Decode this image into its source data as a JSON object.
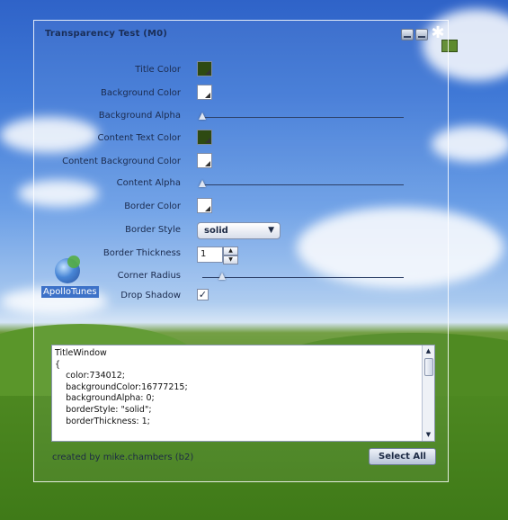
{
  "window": {
    "title": "Transparency Test (M0)",
    "buttons": [
      "minimize",
      "maximize",
      "close"
    ]
  },
  "form": {
    "title_color_label": "Title Color",
    "title_color_value": "#2e4a12",
    "background_color_label": "Background Color",
    "background_color_value": "#ffffff",
    "background_alpha_label": "Background Alpha",
    "background_alpha_value": 0,
    "content_text_color_label": "Content Text Color",
    "content_text_color_value": "#2e4a12",
    "content_background_color_label": "Content Background Color",
    "content_background_color_value": "#ffffff",
    "content_alpha_label": "Content Alpha",
    "content_alpha_value": 0,
    "border_color_label": "Border Color",
    "border_color_value": "#ffffff",
    "border_style_label": "Border Style",
    "border_style_value": "solid",
    "border_thickness_label": "Border Thickness",
    "border_thickness_value": "1",
    "corner_radius_label": "Corner Radius",
    "corner_radius_value": 0.1,
    "drop_shadow_label": "Drop Shadow",
    "drop_shadow_checked": true
  },
  "code": {
    "lines": [
      "TitleWindow",
      "{",
      "    color:734012;",
      "    backgroundColor:16777215;",
      "    backgroundAlpha: 0;",
      "    borderStyle: \"solid\";",
      "    borderThickness: 1;"
    ]
  },
  "footer": {
    "credit": "created by mike.chambers (b2)",
    "select_all_label": "Select All"
  },
  "desktop": {
    "icon_label": "ApolloTunes"
  }
}
